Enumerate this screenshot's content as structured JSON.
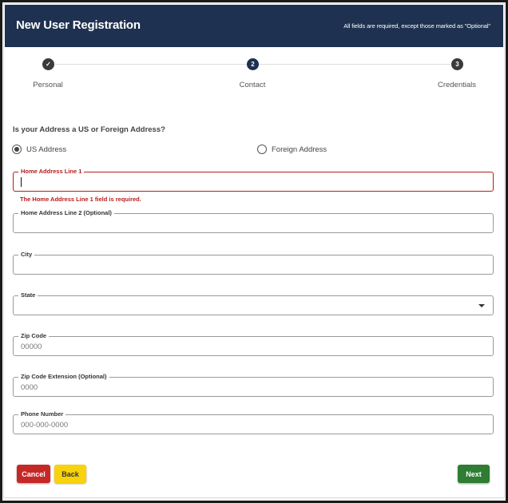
{
  "header": {
    "title": "New User Registration",
    "note": "All fields are required, except those marked as \"Optional\"",
    "background": "#1f3150"
  },
  "stepper": {
    "steps": [
      {
        "label": "Personal",
        "marker": "✓",
        "state": "completed"
      },
      {
        "label": "Contact",
        "marker": "2",
        "state": "active"
      },
      {
        "label": "Credentials",
        "marker": "3",
        "state": "upcoming"
      }
    ]
  },
  "address_type": {
    "question": "Is your Address a US or Foreign Address?",
    "options": [
      {
        "label": "US Address",
        "selected": true
      },
      {
        "label": "Foreign Address",
        "selected": false
      }
    ]
  },
  "fields": {
    "address1": {
      "label": "Home Address Line 1",
      "value": "",
      "error": "The Home Address Line 1 field is required."
    },
    "address2": {
      "label": "Home Address Line 2 (Optional)",
      "value": ""
    },
    "city": {
      "label": "City",
      "value": ""
    },
    "state": {
      "label": "State",
      "value": ""
    },
    "zip": {
      "label": "Zip Code",
      "placeholder": "00000"
    },
    "zip_ext": {
      "label": "Zip Code Extension (Optional)",
      "placeholder": "0000"
    },
    "phone": {
      "label": "Phone Number",
      "placeholder": "000-000-0000"
    }
  },
  "buttons": {
    "cancel": "Cancel",
    "back": "Back",
    "next": "Next"
  },
  "colors": {
    "error": "#b71c1c",
    "cancel": "#c62828",
    "back": "#f8d20c",
    "next": "#2e7d32"
  }
}
